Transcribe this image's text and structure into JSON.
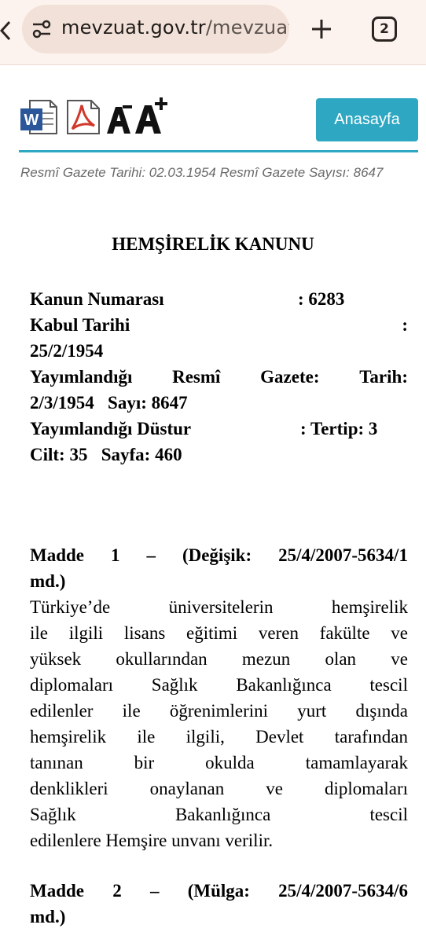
{
  "browser": {
    "url_host": "mevzuat.gov.tr",
    "url_path": "/mevzuat",
    "tab_count": "2"
  },
  "toolbar": {
    "word_label": "W",
    "home_label": "Anasayfa"
  },
  "gazette": {
    "line": "Resmî Gazete Tarihi: 02.03.1954 Resmî Gazete Sayısı: 8647"
  },
  "law": {
    "title": "HEMŞİRELİK KANUNU",
    "info": {
      "number_label": "Kanun Numarası",
      "number_value": ": 6283",
      "acceptance_label": "Kabul  Tarihi",
      "acceptance_colon": ":",
      "acceptance_date": "25/2/1954",
      "gazette_label_a": "Yayımlandığı",
      "gazette_label_b": "Resmî",
      "gazette_label_c": "Gazete:",
      "gazette_label_d": "Tarih:",
      "gazette_date_issue": "2/3/1954   Sayı: 8647",
      "dustur_label": "Yayımlandığı Düstur",
      "dustur_value": ": Tertip: 3",
      "volume_page": "Cilt: 35   Sayfa: 460"
    },
    "articles": [
      {
        "heading_line1": [
          "Madde",
          "1",
          "–",
          "(Değişik:",
          "25/4/2007-5634/1"
        ],
        "heading_line2": "md.)",
        "body_lines": [
          [
            "Türkiye’de",
            "üniversitelerin",
            "hemşirelik"
          ],
          [
            "ile",
            "ilgili",
            "lisans",
            "eğitimi",
            "veren",
            "fakülte",
            "ve"
          ],
          [
            "yüksek",
            "okullarından",
            "mezun",
            "olan",
            "ve"
          ],
          [
            "diplomaları",
            "Sağlık",
            "Bakanlığınca",
            "tescil"
          ],
          [
            "edilenler",
            "ile",
            "öğrenimlerini",
            "yurt",
            "dışında"
          ],
          [
            "hemşirelik",
            "ile",
            "ilgili,",
            "Devlet",
            "tarafından"
          ],
          [
            "tanınan",
            "bir",
            "okulda",
            "tamamlayarak"
          ],
          [
            "denklikleri",
            "onaylanan",
            "ve",
            "diplomaları"
          ],
          [
            "Sağlık",
            "Bakanlığınca",
            "tescil"
          ]
        ],
        "body_last_line": "edilenlere Hemşire unvanı verilir."
      },
      {
        "heading_line1": [
          "Madde",
          "2",
          "–",
          "(Mülga:",
          "25/4/2007-5634/6"
        ],
        "heading_line2": "md.)"
      }
    ]
  }
}
